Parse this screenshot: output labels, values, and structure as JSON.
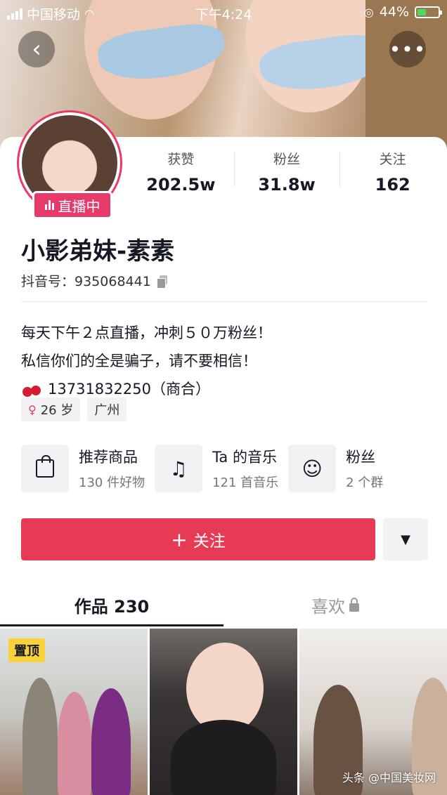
{
  "status_bar": {
    "carrier": "中国移动",
    "time": "下午4:24",
    "battery": "44%",
    "battery_level": 0.44
  },
  "nav": {
    "back_icon": "chevron-left-icon",
    "more_icon": "more-dots-icon"
  },
  "profile": {
    "live_badge": "直播中",
    "stats": [
      {
        "label": "获赞",
        "value": "202.5w"
      },
      {
        "label": "粉丝",
        "value": "31.8w"
      },
      {
        "label": "关注",
        "value": "162"
      }
    ],
    "nickname": "小影弟妹-素素",
    "douyin_id": "抖音号：935068441",
    "bio_lines": [
      "每天下午２点直播，冲刺５０万粉丝！",
      "私信你们的全是骗子，请不要相信！",
      "13731832250（商合）"
    ],
    "tags": [
      "26 岁",
      "广州"
    ]
  },
  "features": [
    {
      "title": "推荐商品",
      "subtitle": "130 件好物"
    },
    {
      "title": "Ta 的音乐",
      "subtitle": "121 首音乐"
    },
    {
      "title": "粉丝",
      "subtitle": "2 个群"
    }
  ],
  "actions": {
    "follow_label": "关注"
  },
  "tabs": [
    {
      "label": "作品 230"
    },
    {
      "label": "喜欢"
    }
  ],
  "videos": {
    "pinned_label": "置顶",
    "watermark": "头条 @中国美妆网"
  },
  "colors": {
    "accent": "#e63a55",
    "live": "#e63a6b"
  }
}
